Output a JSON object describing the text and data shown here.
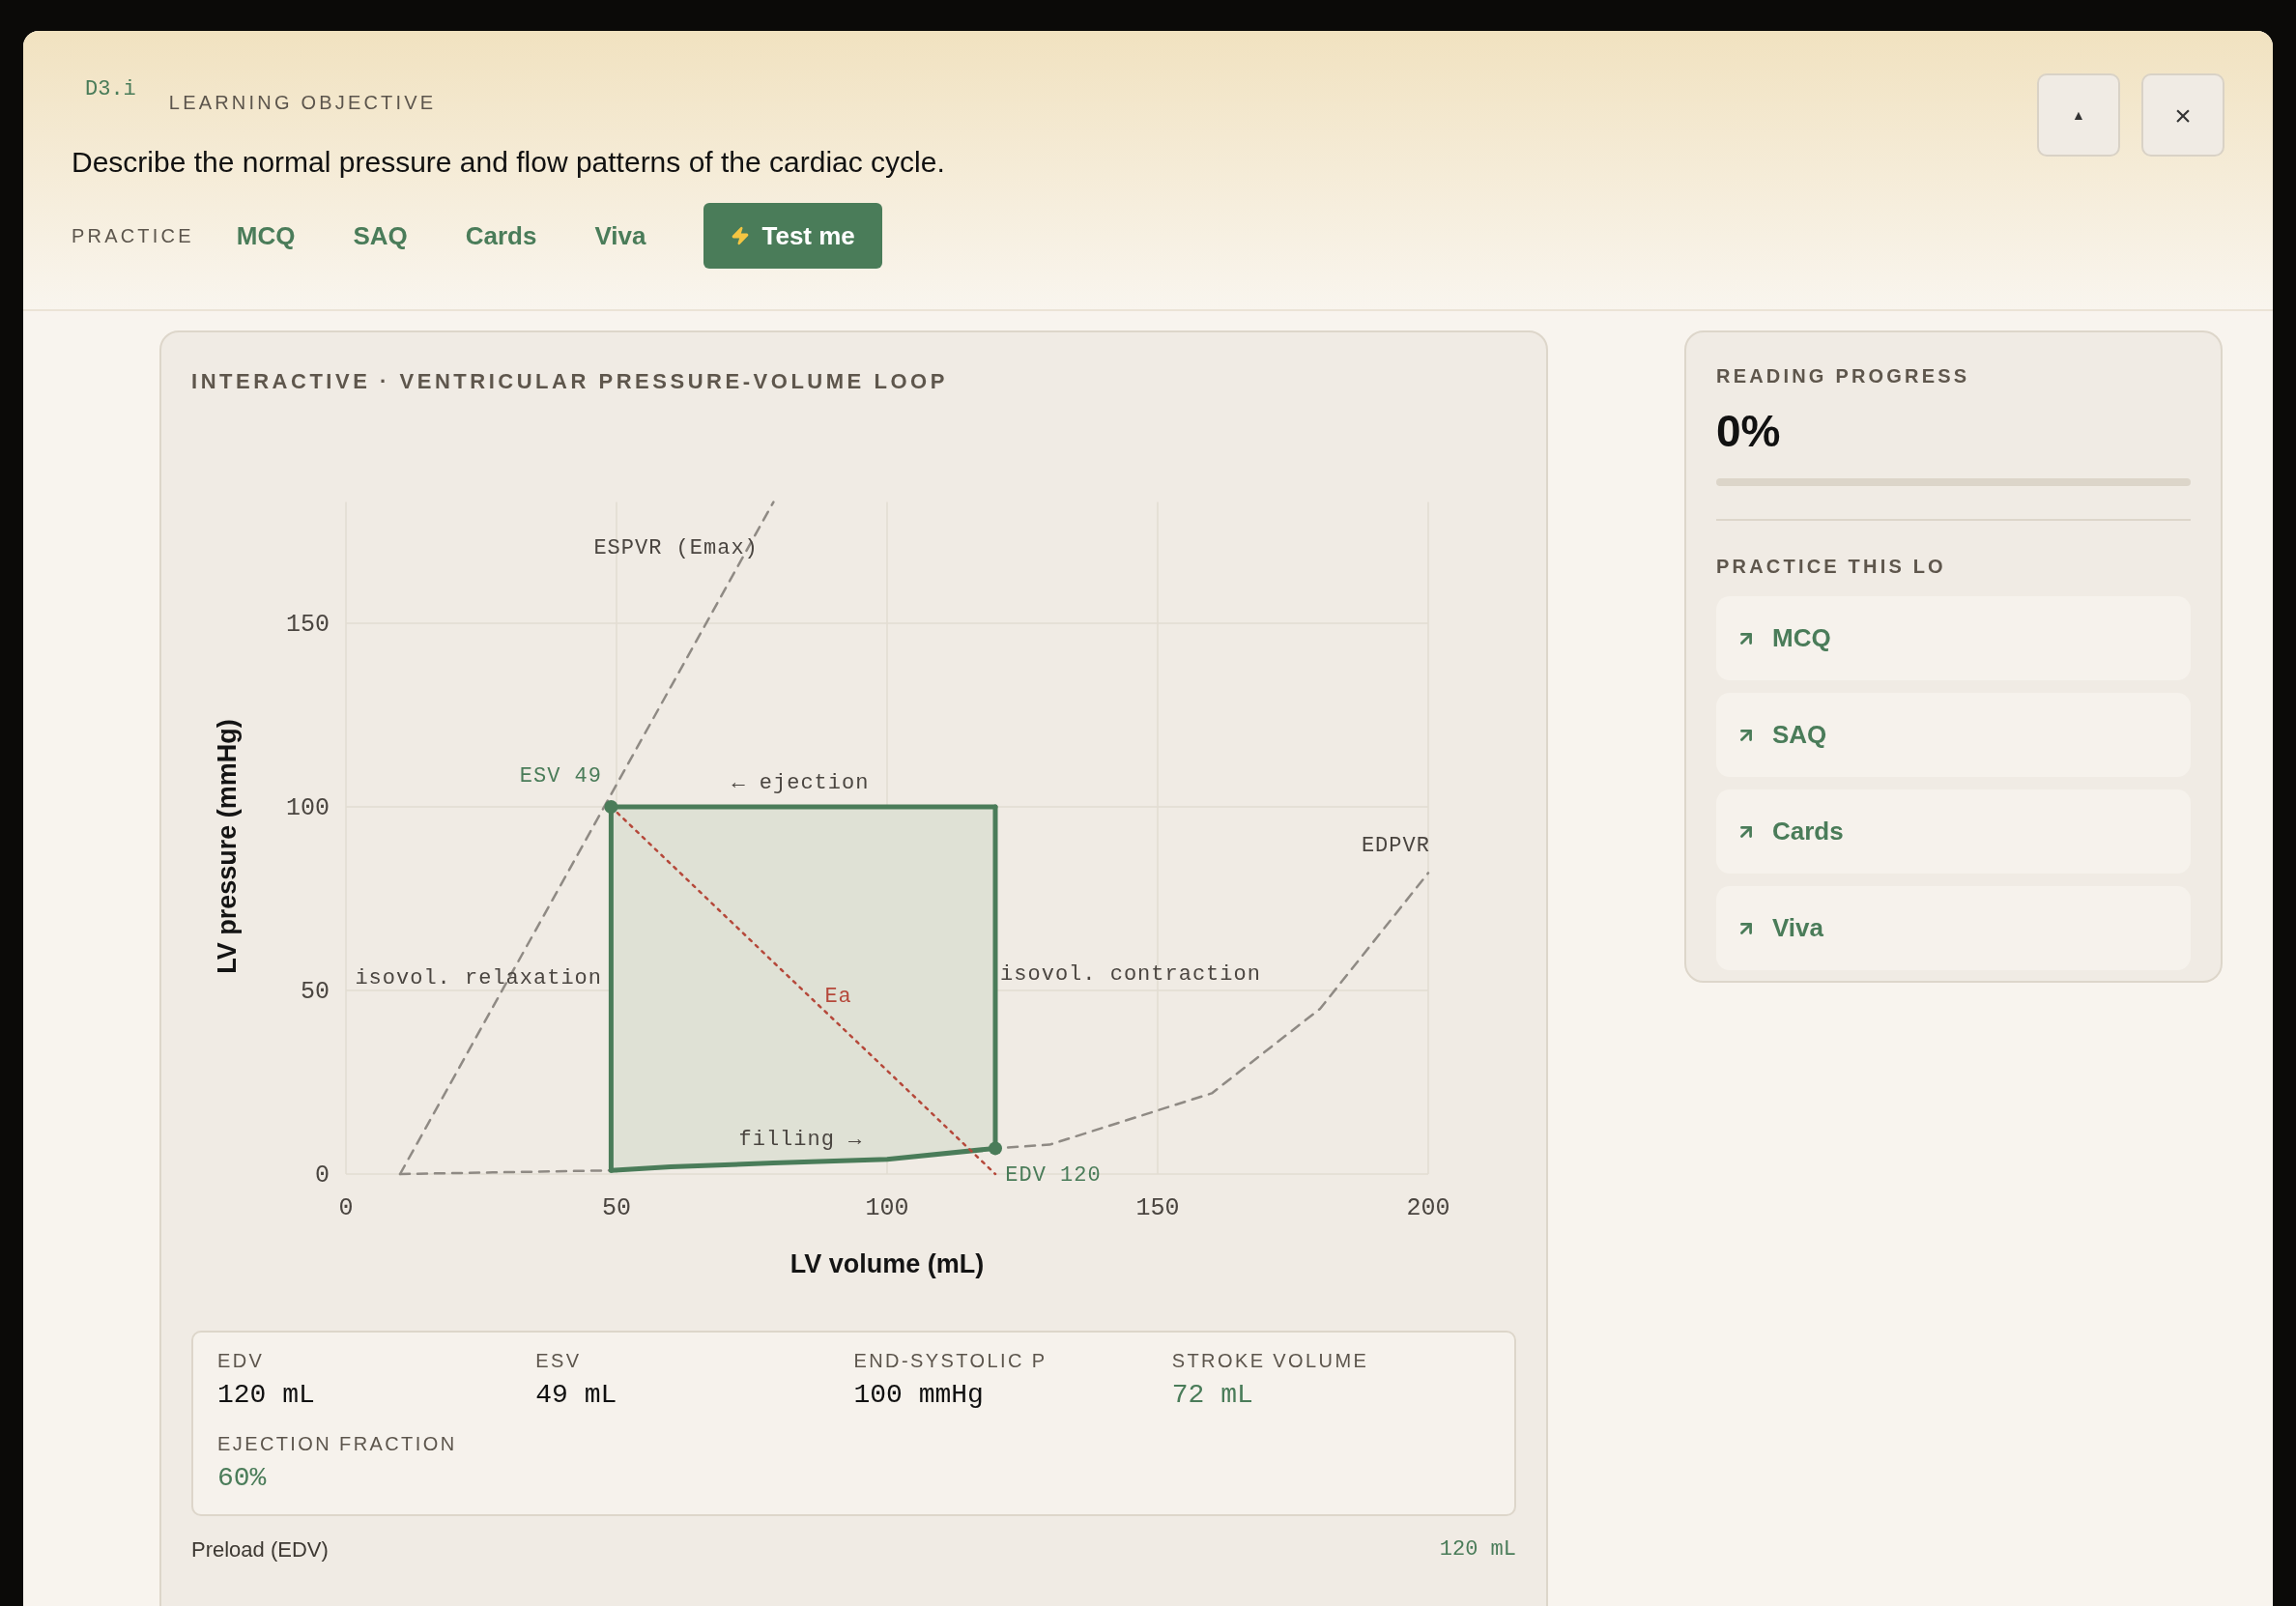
{
  "header": {
    "code": "D3.i",
    "eyebrow": "LEARNING OBJECTIVE",
    "objective": "Describe the normal pressure and flow patterns of the cardiac cycle.",
    "practice_label": "PRACTICE",
    "practice": [
      {
        "label": "MCQ",
        "kind": "link"
      },
      {
        "label": "SAQ",
        "kind": "link"
      },
      {
        "label": "Cards",
        "kind": "link"
      },
      {
        "label": "Viva",
        "kind": "link"
      },
      {
        "label": "Test me",
        "kind": "button"
      }
    ],
    "window_buttons": [
      "▲",
      "×"
    ]
  },
  "main": {
    "title": "INTERACTIVE · VENTRICULAR PRESSURE-VOLUME LOOP",
    "chart_data": {
      "type": "line",
      "xlabel": "LV volume (mL)",
      "ylabel": "LV pressure (mmHg)",
      "xlim": [
        0,
        200
      ],
      "ylim": [
        0,
        183
      ],
      "xticks": [
        0,
        50,
        100,
        150,
        200
      ],
      "yticks": [
        0,
        50,
        100,
        150
      ],
      "grid": true,
      "x": [
        10,
        49,
        60,
        79,
        100,
        120,
        130,
        160,
        180,
        200
      ],
      "series": [
        {
          "name": "ESPVR (Emax)",
          "color": "#8f8a84",
          "line_style": "dashed",
          "values": [
            0,
            103.4,
            132.6,
            183,
            null,
            null,
            null,
            null,
            null,
            null
          ]
        },
        {
          "name": "EDPVR",
          "color": "#8f8a84",
          "line_style": "dashed",
          "values": [
            0,
            1,
            2,
            3,
            4,
            7,
            8,
            22,
            45,
            82
          ]
        },
        {
          "name": "← ejection",
          "color": "#4a7c59",
          "line_style": "solid",
          "values": [
            null,
            100,
            100,
            100,
            100,
            100,
            null,
            null,
            null,
            null
          ]
        },
        {
          "name": "filling →",
          "color": "#4a7c59",
          "line_style": "solid",
          "values": [
            null,
            1,
            2,
            3,
            4,
            7,
            null,
            null,
            null,
            null
          ]
        },
        {
          "name": "Ea",
          "color": "#b5483a",
          "line_style": "dotted",
          "values": [
            null,
            100,
            84.5,
            57.7,
            28.2,
            0,
            null,
            null,
            null,
            null
          ]
        }
      ],
      "annotations": [
        {
          "text": "ESV 49",
          "x": 49,
          "y": 100
        },
        {
          "text": "EDV 120",
          "x": 120,
          "y": 7
        },
        "isovol. relaxation",
        "isovol. contraction"
      ]
    },
    "stats": [
      {
        "label": "EDV",
        "value": "120 mL",
        "highlight": false
      },
      {
        "label": "ESV",
        "value": "49 mL",
        "highlight": false
      },
      {
        "label": "END-SYSTOLIC P",
        "value": "100 mmHg",
        "highlight": false
      },
      {
        "label": "STROKE VOLUME",
        "value": "72 mL",
        "highlight": true
      },
      {
        "label": "EJECTION FRACTION",
        "value": "60%",
        "highlight": true
      }
    ],
    "control": {
      "label": "Preload (EDV)",
      "reading": "120 mL"
    }
  },
  "sidebar": {
    "progress_title": "READING PROGRESS",
    "progress_value": "0%",
    "level": 0,
    "practice_title": "PRACTICE THIS LO",
    "practice": [
      "MCQ",
      "SAQ",
      "Cards",
      "Viva"
    ]
  }
}
